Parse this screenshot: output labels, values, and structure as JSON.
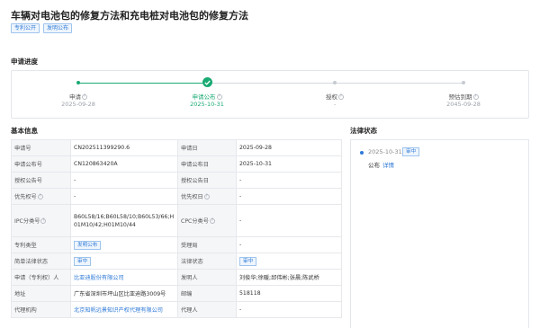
{
  "title": "车辆对电池包的修复方法和充电桩对电池包的修复方法",
  "tags": [
    "专利公开",
    "发明公布"
  ],
  "progress": {
    "section_title": "申请进度",
    "steps": [
      {
        "label": "申请",
        "date": "2025-09-28",
        "state": "done"
      },
      {
        "label": "申请公布",
        "date": "2025-10-31",
        "state": "current"
      },
      {
        "label": "授权",
        "date": "-",
        "state": "pending"
      },
      {
        "label": "预估到期",
        "date": "2045-09-28",
        "state": "pending"
      }
    ]
  },
  "basic_info": {
    "section_title": "基本信息",
    "rows": [
      {
        "k1": "申请号",
        "v1": "CN202511399290.6",
        "k2": "申请日",
        "v2": "2025-09-28"
      },
      {
        "k1": "申请公布号",
        "v1": "CN120863420A",
        "k2": "申请公布日",
        "v2": "2025-10-31"
      },
      {
        "k1": "授权公告号",
        "v1": "-",
        "k2": "授权公告日",
        "v2": "-"
      },
      {
        "k1": "优先权号",
        "v1": "-",
        "k2": "优先权日",
        "v2": "-"
      },
      {
        "k1": "IPC分类号",
        "v1": "B60L58/16;B60L58/10;B60L53/66;H01M10/42;H01M10/44",
        "k2": "CPC分类号",
        "v2": "-"
      },
      {
        "k1": "专利类型",
        "v1": "发明公布",
        "k2": "受理局",
        "v2": "-"
      },
      {
        "k1": "简单法律状态",
        "v1": "审中",
        "k2": "法律状态",
        "v2": "审中"
      },
      {
        "k1": "申请（专利权）人",
        "v1": "比亚迪股份有限公司",
        "k2": "发明人",
        "v2": "刘俊华;徐暖;邱伟彬;张晨;陈武桥"
      },
      {
        "k1": "地址",
        "v1": "广东省深圳市坪山区比亚迪路3009号",
        "k2": "邮编",
        "v2": "518118"
      },
      {
        "k1": "代理机构",
        "v1": "北京知帆远景知识产权代理有限公司",
        "k2": "代理人",
        "v2": "-"
      }
    ]
  },
  "legal_status": {
    "section_title": "法律状态",
    "entries": [
      {
        "date": "2025-10-31",
        "badge": "审中",
        "text": "公布",
        "link": "详情"
      }
    ]
  },
  "icons": {
    "help": "help-circle-icon",
    "check": "check-circle-icon"
  },
  "colors": {
    "accent": "#2f7ad6",
    "success": "#1aaa74"
  }
}
